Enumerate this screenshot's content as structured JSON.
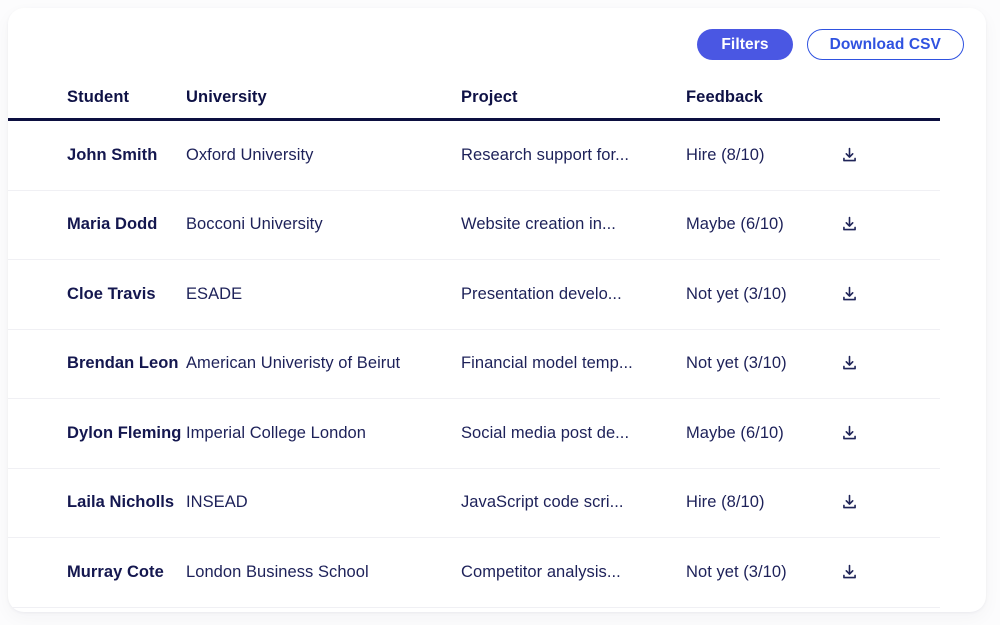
{
  "toolbar": {
    "filters_label": "Filters",
    "download_csv_label": "Download CSV",
    "filters_color": "#4a57e3",
    "csv_border_color": "#2f52e0"
  },
  "table": {
    "columns": [
      {
        "key": "student",
        "label": "Student"
      },
      {
        "key": "university",
        "label": "University"
      },
      {
        "key": "project",
        "label": "Project"
      },
      {
        "key": "feedback",
        "label": "Feedback"
      },
      {
        "key": "action",
        "label": ""
      }
    ],
    "header_rule_color": "#0c0f40",
    "rows": [
      {
        "student": "John Smith",
        "university": "Oxford University",
        "project": "Research support for...",
        "feedback": "Hire (8/10)",
        "action_icon": "download-icon"
      },
      {
        "student": "Maria Dodd",
        "university": "Bocconi University",
        "project": "Website creation in...",
        "feedback": "Maybe (6/10)",
        "action_icon": "download-icon"
      },
      {
        "student": "Cloe Travis",
        "university": "ESADE",
        "project": "Presentation develo...",
        "feedback": "Not yet (3/10)",
        "action_icon": "download-icon"
      },
      {
        "student": "Brendan Leon",
        "university": "American Univeristy of Beirut",
        "project": "Financial model temp...",
        "feedback": "Not yet (3/10)",
        "action_icon": "download-icon"
      },
      {
        "student": "Dylon Fleming",
        "university": "Imperial College London",
        "project": "Social media post de...",
        "feedback": "Maybe (6/10)",
        "action_icon": "download-icon"
      },
      {
        "student": "Laila Nicholls",
        "university": "INSEAD",
        "project": "JavaScript code scri...",
        "feedback": "Hire (8/10)",
        "action_icon": "download-icon"
      },
      {
        "student": "Murray Cote",
        "university": "London Business School",
        "project": "Competitor analysis...",
        "feedback": "Not yet (3/10)",
        "action_icon": "download-icon"
      }
    ]
  }
}
